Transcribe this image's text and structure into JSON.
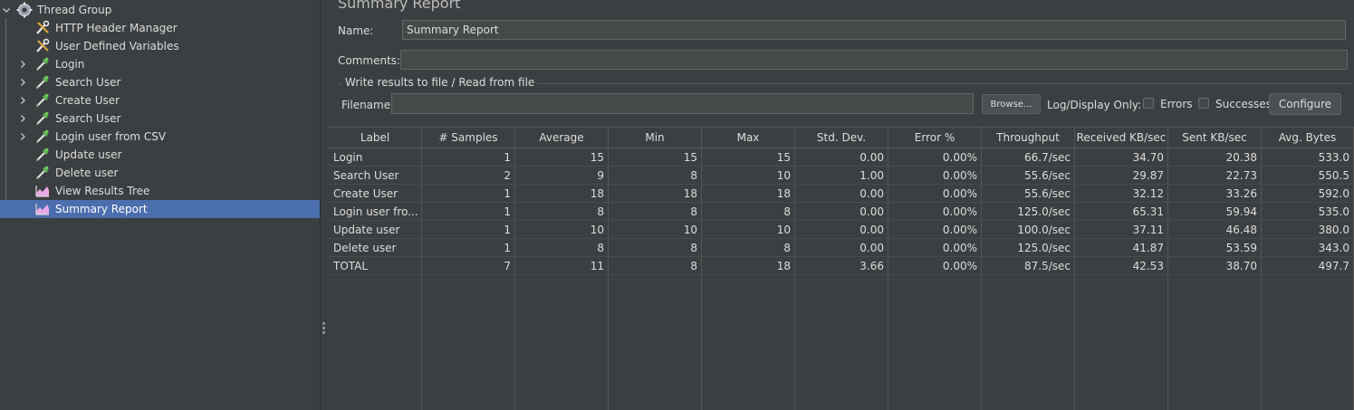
{
  "tree": {
    "items": [
      {
        "label": "Thread Group",
        "icon": "gear-icon",
        "expander": "chevron-down"
      },
      {
        "label": "HTTP Header Manager",
        "icon": "wrench-icon",
        "expander": ""
      },
      {
        "label": "User Defined Variables",
        "icon": "wrench-icon",
        "expander": ""
      },
      {
        "label": "Login",
        "icon": "sampler-pipette-icon",
        "expander": "chevron-right"
      },
      {
        "label": "Search User",
        "icon": "sampler-pipette-icon",
        "expander": "chevron-right"
      },
      {
        "label": "Create User",
        "icon": "sampler-pipette-icon",
        "expander": "chevron-right"
      },
      {
        "label": "Search User",
        "icon": "sampler-pipette-icon",
        "expander": "chevron-right"
      },
      {
        "label": "Login user from CSV",
        "icon": "sampler-pipette-icon",
        "expander": "chevron-right"
      },
      {
        "label": "Update user",
        "icon": "sampler-pipette-icon",
        "expander": ""
      },
      {
        "label": "Delete user",
        "icon": "sampler-pipette-icon",
        "expander": ""
      },
      {
        "label": "View Results Tree",
        "icon": "chart-listener-icon",
        "expander": ""
      },
      {
        "label": "Summary Report",
        "icon": "chart-listener-icon",
        "expander": "",
        "selected": true
      }
    ]
  },
  "panel": {
    "title": "Summary Report",
    "name_label": "Name:",
    "name_value": "Summary Report",
    "comments_label": "Comments:",
    "comments_value": "",
    "write_group_label": "Write results to file / Read from file",
    "filename_label": "Filename",
    "filename_value": "",
    "browse_label": "Browse...",
    "log_display_label": "Log/Display Only:",
    "errors_label": "Errors",
    "successes_label": "Successes",
    "configure_label": "Configure"
  },
  "table": {
    "columns": [
      "Label",
      "# Samples",
      "Average",
      "Min",
      "Max",
      "Std. Dev.",
      "Error %",
      "Throughput",
      "Received KB/sec",
      "Sent KB/sec",
      "Avg. Bytes"
    ],
    "rows": [
      [
        "Login",
        "1",
        "15",
        "15",
        "15",
        "0.00",
        "0.00%",
        "66.7/sec",
        "34.70",
        "20.38",
        "533.0"
      ],
      [
        "Search User",
        "2",
        "9",
        "8",
        "10",
        "1.00",
        "0.00%",
        "55.6/sec",
        "29.87",
        "22.73",
        "550.5"
      ],
      [
        "Create User",
        "1",
        "18",
        "18",
        "18",
        "0.00",
        "0.00%",
        "55.6/sec",
        "32.12",
        "33.26",
        "592.0"
      ],
      [
        "Login user fro...",
        "1",
        "8",
        "8",
        "8",
        "0.00",
        "0.00%",
        "125.0/sec",
        "65.31",
        "59.94",
        "535.0"
      ],
      [
        "Update user",
        "1",
        "10",
        "10",
        "10",
        "0.00",
        "0.00%",
        "100.0/sec",
        "37.11",
        "46.48",
        "380.0"
      ],
      [
        "Delete user",
        "1",
        "8",
        "8",
        "8",
        "0.00",
        "0.00%",
        "125.0/sec",
        "41.87",
        "53.59",
        "343.0"
      ],
      [
        "TOTAL",
        "7",
        "11",
        "8",
        "18",
        "3.66",
        "0.00%",
        "87.5/sec",
        "42.53",
        "38.70",
        "497.7"
      ]
    ]
  },
  "colors": {
    "background": "#3c3f41",
    "selection": "#4b6eaf",
    "field": "#45494a",
    "text": "#dcdcdc"
  }
}
